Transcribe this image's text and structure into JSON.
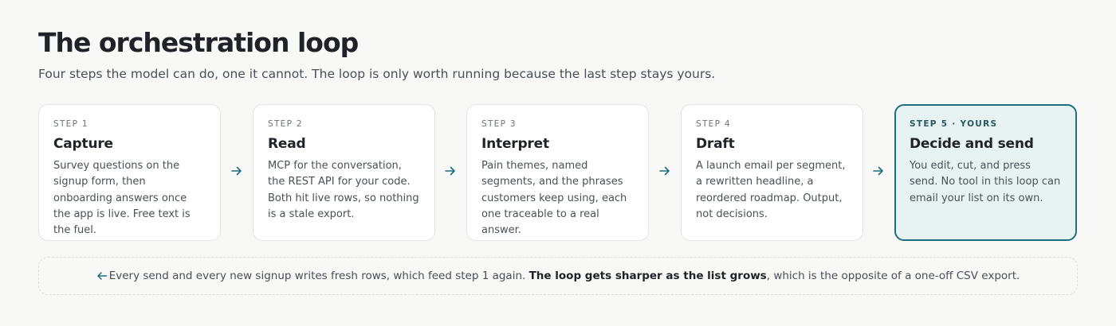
{
  "header": {
    "title": "The orchestration loop",
    "subtitle": "Four steps the model can do, one it cannot. The loop is only worth running because the last step stays yours."
  },
  "steps": [
    {
      "label": "STEP 1",
      "title": "Capture",
      "desc": "Survey questions on the signup form, then onboarding answers once the app is live. Free text is the fuel."
    },
    {
      "label": "STEP 2",
      "title": "Read",
      "desc": "MCP for the conversation, the REST API for your code. Both hit live rows, so nothing is a stale export."
    },
    {
      "label": "STEP 3",
      "title": "Interpret",
      "desc": "Pain themes, named segments, and the phrases customers keep using, each one traceable to a real answer."
    },
    {
      "label": "STEP 4",
      "title": "Draft",
      "desc": "A launch email per segment, a rewritten headline, a reordered roadmap. Output, not decisions."
    },
    {
      "label": "STEP 5 · YOURS",
      "title": "Decide and send",
      "desc": "You edit, cut, and press send. No tool in this loop can email your list on its own."
    }
  ],
  "footer": {
    "text_before": "Every send and every new signup writes fresh rows, which feed step 1 again. ",
    "text_bold": "The loop gets sharper as the list grows",
    "text_after": ", which is the opposite of a one-off CSV export."
  },
  "colors": {
    "accent": "#1e6f7e",
    "highlight_bg": "#e7f3f3"
  },
  "icons": {
    "step_arrow": "arrow-right-icon",
    "loop_back": "arrow-left-icon"
  }
}
